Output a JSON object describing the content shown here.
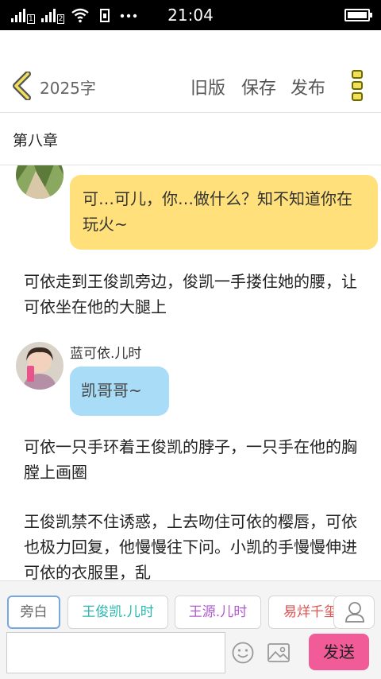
{
  "status_bar": {
    "time": "21:04",
    "sim1": "1",
    "sim2": "2",
    "icons": [
      "signal-icon",
      "signal-icon",
      "wifi-icon",
      "sim-card-icon",
      "more-dots-icon",
      "battery-icon"
    ]
  },
  "header": {
    "back_icon": "chevron-left-icon",
    "word_count": "2025字",
    "old_version": "旧版",
    "save": "保存",
    "publish": "发布",
    "menu_icon": "more-vertical-icon"
  },
  "chapter_title": "第八章",
  "messages": [
    {
      "type": "dialogue",
      "speaker": "",
      "avatar": "avatar-icon",
      "text": "可…可儿，你…做什么？知不知道你在玩火~",
      "color": "#ffe07a"
    },
    {
      "type": "narration",
      "text": "可依走到王俊凯旁边，俊凯一手搂住她的腰，让可依坐在他的大腿上"
    },
    {
      "type": "dialogue",
      "speaker": "蓝可依.儿时",
      "avatar": "avatar-icon",
      "text": "凯哥哥~",
      "color": "#a8dcf7"
    },
    {
      "type": "narration",
      "text": "可依一只手环着王俊凯的脖子，一只手在他的胸膛上画圈"
    },
    {
      "type": "narration",
      "text": "王俊凯禁不住诱惑，上去吻住可依的樱唇，可依也极力回复，他慢慢往下问。小凯的手慢慢伸进可依的衣服里，乱"
    }
  ],
  "roles": [
    {
      "label": "旁白",
      "color": "#666666",
      "selected": true
    },
    {
      "label": "王俊凯.儿时",
      "color": "#2ab7b0",
      "selected": false
    },
    {
      "label": "王源.儿时",
      "color": "#b05ad0",
      "selected": false
    },
    {
      "label": "易烊千玺",
      "color": "#e05050",
      "selected": false
    }
  ],
  "input": {
    "placeholder": ""
  },
  "send_label": "发送",
  "bottom_icons": [
    "add-person-icon",
    "emoji-icon",
    "image-icon"
  ]
}
